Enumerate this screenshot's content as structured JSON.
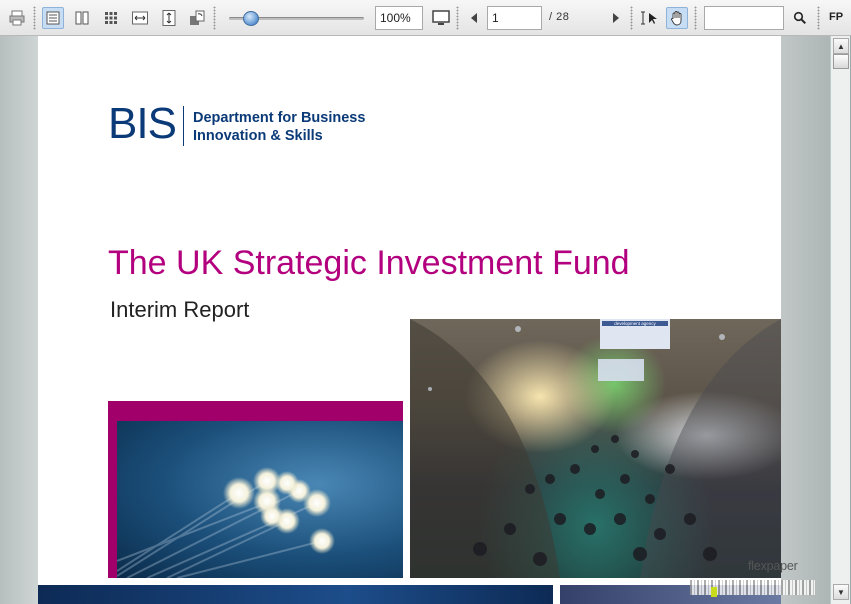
{
  "toolbar": {
    "zoom_value": "100%",
    "page_input": "1",
    "page_total": "/  28",
    "search_value": "",
    "brand": "FP",
    "zoom_level": 0.12,
    "icons": {
      "print": "print-icon",
      "single_page": "single-page-icon",
      "two_page": "two-page-icon",
      "thumbnails": "thumbnails-icon",
      "fit_width": "fit-width-icon",
      "fit_height": "fit-height-icon",
      "rotate": "rotate-icon",
      "fullscreen": "fullscreen-icon",
      "prev": "previous-page-icon",
      "next": "next-page-icon",
      "text_select": "text-select-icon",
      "hand": "hand-tool-icon",
      "search": "search-icon"
    }
  },
  "document": {
    "logo_mark": "BIS",
    "department": [
      "Department for Business",
      "Innovation & Skills"
    ],
    "title": "The UK Strategic Investment Fund",
    "subtitle": "Interim Report",
    "banner_text": "development agency"
  },
  "watermark": "flexpaper",
  "colors": {
    "bis_blue": "#0b3a78",
    "title_magenta": "#b3007e",
    "frame_magenta": "#a1006b",
    "active_button": "#c6ddf4"
  }
}
